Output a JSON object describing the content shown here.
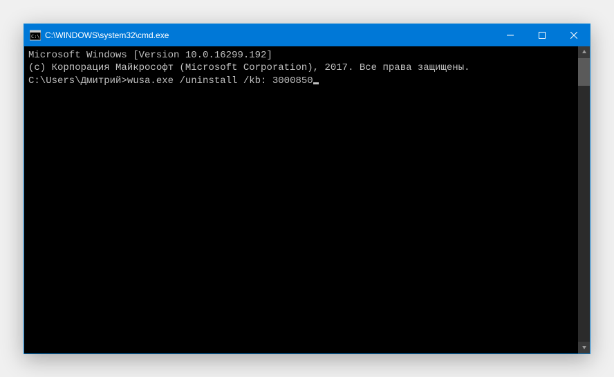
{
  "window": {
    "title": "C:\\WINDOWS\\system32\\cmd.exe"
  },
  "terminal": {
    "line1": "Microsoft Windows [Version 10.0.16299.192]",
    "line2": "(c) Корпорация Майкрософт (Microsoft Corporation), 2017. Все права защищены.",
    "blank": "",
    "prompt": "C:\\Users\\Дмитрий>",
    "command": "wusa.exe /uninstall /kb: 3000850"
  }
}
